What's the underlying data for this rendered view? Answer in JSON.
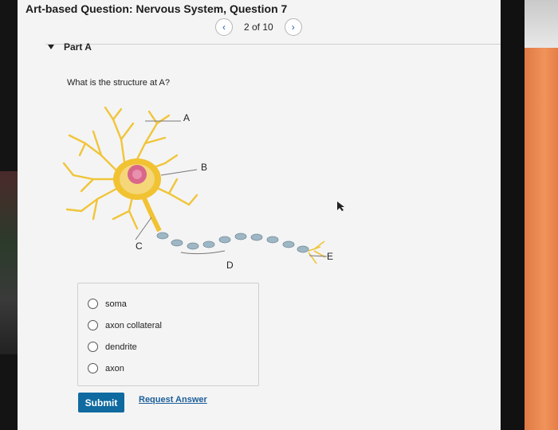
{
  "page": {
    "title": "Art-based Question: Nervous System, Question 7"
  },
  "pager": {
    "prev_icon": "‹",
    "status": "2 of 10",
    "next_icon": "›"
  },
  "part": {
    "label": "Part A"
  },
  "question": {
    "text": "What is the structure at A?"
  },
  "figure": {
    "labels": {
      "a": "A",
      "b": "B",
      "c": "C",
      "d": "D",
      "e": "E"
    }
  },
  "options": [
    {
      "label": "soma"
    },
    {
      "label": "axon collateral"
    },
    {
      "label": "dendrite"
    },
    {
      "label": "axon"
    }
  ],
  "actions": {
    "submit": "Submit",
    "request_answer": "Request Answer"
  },
  "colors": {
    "accent": "#0f6aa0",
    "link": "#1b5e9b",
    "neuron": "#f1c232"
  }
}
